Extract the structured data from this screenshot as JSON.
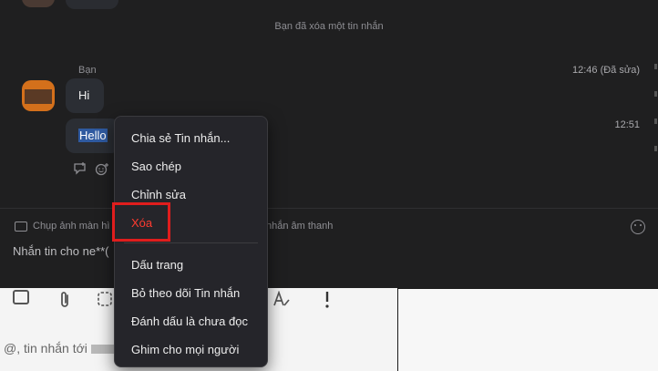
{
  "chat": {
    "deleted_notice": "Bạn đã xóa một tin nhắn",
    "sender_name": "Bạn",
    "messages": [
      {
        "text": "Hi",
        "time": "12:46 (Đã sửa)"
      },
      {
        "text": "Hello",
        "time": "12:51"
      }
    ]
  },
  "composer": {
    "screenshot_label": "Chụp ảnh màn hì",
    "voice_label": "nhắn âm thanh",
    "placeholder": "Nhắn tin cho ne**("
  },
  "lower": {
    "placeholder": "@, tin nhắn tới"
  },
  "context_menu": {
    "items": [
      "Chia sẻ Tin nhắn...",
      "Sao chép",
      "Chỉnh sửa",
      "Xóa",
      "Dấu trang",
      "Bỏ theo dõi Tin nhắn",
      "Đánh dấu là chưa đọc",
      "Ghim cho mọi người"
    ]
  },
  "colors": {
    "delete": "#ff3b30",
    "highlight": "#e01d1d",
    "avatar": "#d4701b"
  },
  "icons": [
    "reply-thread-icon",
    "add-reaction-icon",
    "screenshot-icon",
    "emoji-icon",
    "image-icon",
    "attach-icon",
    "format-icon",
    "priority-icon"
  ]
}
